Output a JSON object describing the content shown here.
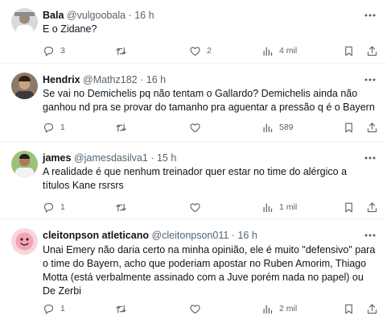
{
  "tweets": [
    {
      "name": "Bala",
      "handle": "@vulgoobala",
      "time": "16 h",
      "text": "E o Zidane?",
      "replies": "3",
      "retweets": "",
      "likes": "2",
      "views": "4 mil",
      "avatar_color": "#bfbfbf"
    },
    {
      "name": "Hendrix",
      "handle": "@Mathz182",
      "time": "16 h",
      "text": "Se vai no Demichelis pq não tentam o Gallardo? Demichelis ainda não ganhou nd pra se provar do tamanho pra aguentar a pressão q é o Bayern",
      "replies": "1",
      "retweets": "",
      "likes": "",
      "views": "589",
      "avatar_color": "#6b5a48"
    },
    {
      "name": "james",
      "handle": "@jamesdasilva1",
      "time": "15 h",
      "text": "A realidade é que nenhum treinador quer estar no time do alérgico a títulos Kane rsrsrs",
      "replies": "1",
      "retweets": "",
      "likes": "",
      "views": "1 mil",
      "avatar_color": "#7ba05b"
    },
    {
      "name": "cleitonpson atleticano",
      "handle": "@cleitonpson011",
      "time": "16 h",
      "text": "Unai Emery não daria certo na minha opinião, ele é muito \"defensivo\" para o time do Bayern, acho que poderiam apostar no Ruben Amorim, Thiago Motta (está verbalmente assinado com a Juve porém nada no papel) ou De Zerbi",
      "replies": "1",
      "retweets": "",
      "likes": "",
      "views": "2 mil",
      "avatar_color": "#f2c1c6"
    }
  ],
  "dot": "·",
  "colors": {
    "text": "#0f1419",
    "secondary": "#536471",
    "divider": "#eff3f4"
  }
}
